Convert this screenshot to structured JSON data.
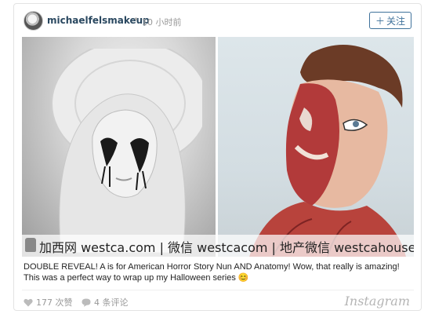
{
  "post": {
    "username": "michaelfelsmakeup",
    "separator": "•",
    "time_ago": "10 小时前",
    "follow_label": "关注",
    "follow_icon": "plus-icon"
  },
  "watermark": {
    "text": "加西网 westca.com | 微信 westcacom | 地产微信 westcahouse"
  },
  "caption": {
    "text": "DOUBLE REVEAL! A is for American Horror Story Nun AND Anatomy! Wow, that really is amazing! This was a perfect way to wrap up my Halloween series 😊"
  },
  "footer": {
    "likes_label": "177 次赞",
    "comments_label": "4 条评论",
    "brand": "Instagram",
    "like_icon": "heart-icon",
    "comment_icon": "speech-bubble-icon"
  },
  "colors": {
    "link_blue": "#3f729b",
    "username": "#2a4860",
    "muted": "#999999"
  }
}
